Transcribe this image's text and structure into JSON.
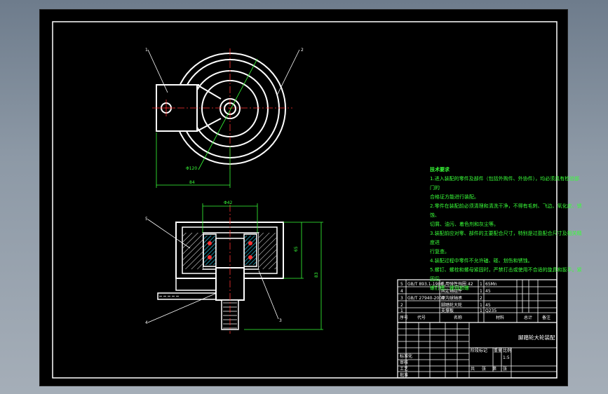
{
  "drawing": {
    "balloons": [
      "1",
      "2",
      "3",
      "4",
      "5"
    ],
    "dims": {
      "circle_dia": "Φ120",
      "width_bottom": "84",
      "bore_top": "Φ42",
      "height_small": "65",
      "height_total": "83"
    }
  },
  "tech_req": {
    "heading": "技术要求",
    "items": [
      "1.进入装配的零件及部件（包括外购件、外协件），均必须具有检验部门的",
      "合格证方能进行装配。",
      "2.零件在装配前必须清理和清洗干净，不得有毛刺、飞边、氧化皮、锈蚀、",
      "切屑、油污、着色剂和灰尘等。",
      "3.装配前应对零、部件的主要配合尺寸，特别是过盈配合尺寸及相关精度进",
      "行复查。",
      "4.装配过程中零件不允许磕、碰、划伤和锈蚀。",
      "5.螺钉、螺栓和螺母紧固时，严禁打击或使用不合适的旋具和扳手。紧固后",
      "螺钉槽、螺母和螺"
    ]
  },
  "title_block": {
    "title": "脚踏轮大轮装配",
    "header_cols": [
      "序号",
      "代号",
      "名称",
      "材料",
      "总计",
      "备注"
    ],
    "parts": [
      [
        "5",
        "GB/T 893.1-1986",
        "孔用弹性挡圈 42",
        "1",
        "65Mn"
      ],
      [
        "4",
        "",
        "固定轴组件",
        "1",
        "45"
      ],
      [
        "3",
        "GB/T 27940-2000",
        "深沟球轴承",
        "2",
        ""
      ],
      [
        "2",
        "",
        "脚踏轮大轮",
        "1",
        "45"
      ],
      [
        "1",
        "",
        "支撑板",
        "1",
        "Q235"
      ]
    ],
    "scale": "1:5",
    "misc": [
      "标准化",
      "审核",
      "工艺",
      "批准",
      "阶段标记",
      "重量",
      "比例",
      "共",
      "张",
      "第",
      "张"
    ]
  }
}
